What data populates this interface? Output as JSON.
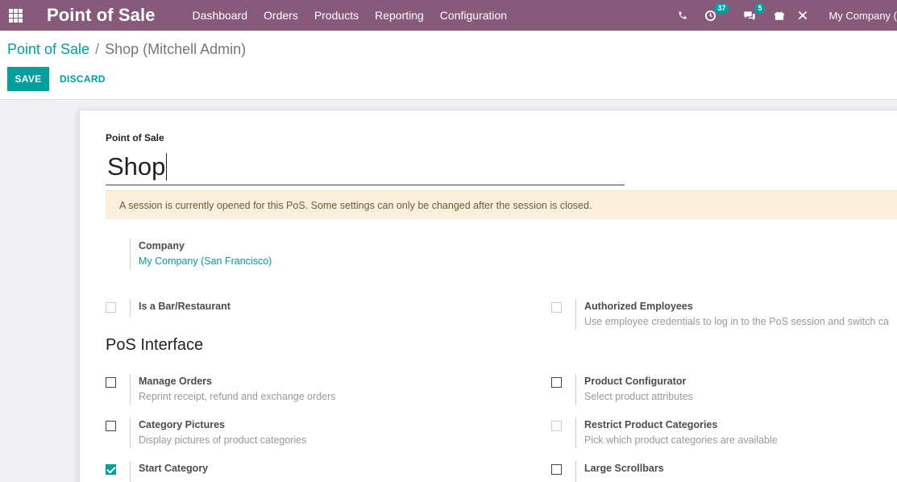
{
  "topbar": {
    "app_title": "Point of Sale",
    "menu": [
      "Dashboard",
      "Orders",
      "Products",
      "Reporting",
      "Configuration"
    ],
    "activity_count": "37",
    "message_count": "5",
    "company": "My Company ("
  },
  "breadcrumb": {
    "parent": "Point of Sale",
    "separator": "/",
    "current": "Shop (Mitchell Admin)"
  },
  "actions": {
    "save_label": "SAVE",
    "discard_label": "DISCARD"
  },
  "form": {
    "name_label": "Point of Sale",
    "name_value": "Shop",
    "alert": "A session is currently opened for this PoS. Some settings can only be changed after the session is closed.",
    "company_label": "Company",
    "company_value": "My Company (San Francisco)",
    "bar_restaurant": {
      "label": "Is a Bar/Restaurant",
      "checked": false
    },
    "authorized_employees": {
      "label": "Authorized Employees",
      "desc": "Use employee credentials to log in to the PoS session and switch ca"
    },
    "section_title": "PoS Interface",
    "manage_orders": {
      "label": "Manage Orders",
      "desc": "Reprint receipt, refund and exchange orders",
      "checked": false
    },
    "product_configurator": {
      "label": "Product Configurator",
      "desc": "Select product attributes",
      "checked": false
    },
    "category_pictures": {
      "label": "Category Pictures",
      "desc": "Display pictures of product categories",
      "checked": false
    },
    "restrict_categories": {
      "label": "Restrict Product Categories",
      "desc": "Pick which product categories are available",
      "checked": false
    },
    "start_category": {
      "label": "Start Category",
      "checked": true
    },
    "large_scrollbars": {
      "label": "Large Scrollbars",
      "checked": false
    }
  },
  "colors": {
    "nav": "#875a7b",
    "accent": "#00a09d",
    "alert_bg": "#fcefdc"
  }
}
